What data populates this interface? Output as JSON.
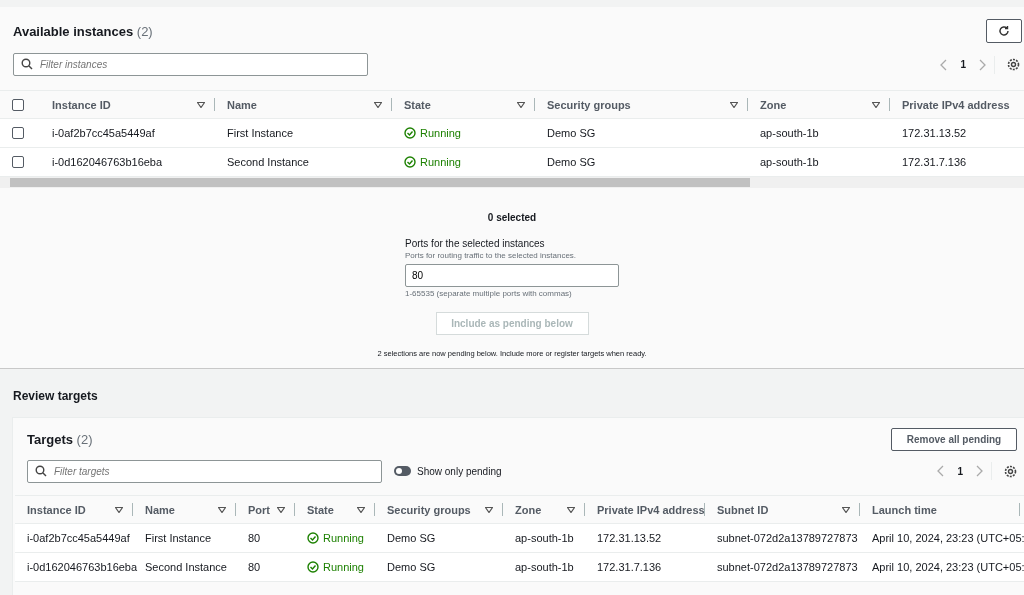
{
  "available": {
    "title": "Available instances",
    "count": "(2)",
    "filter": {
      "placeholder": "Filter instances"
    },
    "page": "1",
    "columns": [
      {
        "label": "Instance ID",
        "filter": true
      },
      {
        "label": "Name",
        "filter": true
      },
      {
        "label": "State",
        "filter": true
      },
      {
        "label": "Security groups",
        "filter": true
      },
      {
        "label": "Zone",
        "filter": true
      },
      {
        "label": "Private IPv4 address",
        "filter": false
      }
    ],
    "all_checked": false,
    "rows": [
      {
        "checked": false,
        "cells": [
          "i-0af2b7cc45a5449af",
          "First Instance",
          "Running",
          "Demo SG",
          "ap-south-1b",
          "172.31.13.52"
        ]
      },
      {
        "checked": false,
        "cells": [
          "i-0d162046763b16eba",
          "Second Instance",
          "Running",
          "Demo SG",
          "ap-south-1b",
          "172.31.7.136"
        ]
      }
    ]
  },
  "selection": {
    "count": "0 selected",
    "ports_label": "Ports for the selected instances",
    "ports_hint": "Ports for routing traffic to the selected instances.",
    "ports_value": "80",
    "ports_constraint": "1-65535 (separate multiple ports with commas)",
    "include_button": {
      "label": "Include as pending below",
      "disabled": true
    },
    "pending_note": "2 selections are now pending below. Include more or register targets when ready."
  },
  "review": {
    "title": "Review targets",
    "targets_title": "Targets",
    "count": "(2)",
    "remove_button": "Remove all pending",
    "filter": {
      "placeholder": "Filter targets"
    },
    "show_only_pending": {
      "label": "Show only pending",
      "on": false
    },
    "page": "1",
    "columns": [
      {
        "label": "Instance ID",
        "filter": true
      },
      {
        "label": "Name",
        "filter": true
      },
      {
        "label": "Port",
        "filter": true
      },
      {
        "label": "State",
        "filter": true
      },
      {
        "label": "Security groups",
        "filter": true
      },
      {
        "label": "Zone",
        "filter": true
      },
      {
        "label": "Private IPv4 address",
        "filter": false
      },
      {
        "label": "Subnet ID",
        "filter": true
      },
      {
        "label": "Launch time",
        "filter": false
      }
    ],
    "rows": [
      {
        "cells": [
          "i-0af2b7cc45a5449af",
          "First Instance",
          "80",
          "Running",
          "Demo SG",
          "ap-south-1b",
          "172.31.13.52",
          "subnet-072d2a13789727873",
          "April 10, 2024, 23:23 (UTC+05:"
        ]
      },
      {
        "cells": [
          "i-0d162046763b16eba",
          "Second Instance",
          "80",
          "Running",
          "Demo SG",
          "ap-south-1b",
          "172.31.7.136",
          "subnet-072d2a13789727873",
          "April 10, 2024, 23:23 (UTC+05:"
        ]
      }
    ]
  }
}
